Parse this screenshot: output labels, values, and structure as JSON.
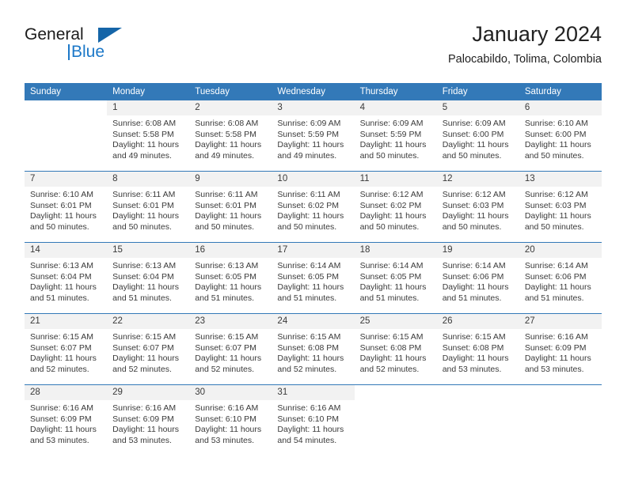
{
  "brand": {
    "word_one": "General",
    "word_two": "Blue",
    "triangle_icon": "triangle-icon",
    "accent_color": "#1c78c8",
    "dark_color": "#1b1b1b"
  },
  "header": {
    "title": "January 2024",
    "subtitle": "Palocabildo, Tolima, Colombia",
    "header_bg": "#3379b8",
    "daynum_bg": "#f2f2f2"
  },
  "weekdays": [
    "Sunday",
    "Monday",
    "Tuesday",
    "Wednesday",
    "Thursday",
    "Friday",
    "Saturday"
  ],
  "weeks": [
    [
      {
        "day": "",
        "sunrise": "",
        "sunset": "",
        "daylight_line1": "",
        "daylight_line2": ""
      },
      {
        "day": "1",
        "sunrise": "Sunrise: 6:08 AM",
        "sunset": "Sunset: 5:58 PM",
        "daylight_line1": "Daylight: 11 hours",
        "daylight_line2": "and 49 minutes."
      },
      {
        "day": "2",
        "sunrise": "Sunrise: 6:08 AM",
        "sunset": "Sunset: 5:58 PM",
        "daylight_line1": "Daylight: 11 hours",
        "daylight_line2": "and 49 minutes."
      },
      {
        "day": "3",
        "sunrise": "Sunrise: 6:09 AM",
        "sunset": "Sunset: 5:59 PM",
        "daylight_line1": "Daylight: 11 hours",
        "daylight_line2": "and 49 minutes."
      },
      {
        "day": "4",
        "sunrise": "Sunrise: 6:09 AM",
        "sunset": "Sunset: 5:59 PM",
        "daylight_line1": "Daylight: 11 hours",
        "daylight_line2": "and 50 minutes."
      },
      {
        "day": "5",
        "sunrise": "Sunrise: 6:09 AM",
        "sunset": "Sunset: 6:00 PM",
        "daylight_line1": "Daylight: 11 hours",
        "daylight_line2": "and 50 minutes."
      },
      {
        "day": "6",
        "sunrise": "Sunrise: 6:10 AM",
        "sunset": "Sunset: 6:00 PM",
        "daylight_line1": "Daylight: 11 hours",
        "daylight_line2": "and 50 minutes."
      }
    ],
    [
      {
        "day": "7",
        "sunrise": "Sunrise: 6:10 AM",
        "sunset": "Sunset: 6:01 PM",
        "daylight_line1": "Daylight: 11 hours",
        "daylight_line2": "and 50 minutes."
      },
      {
        "day": "8",
        "sunrise": "Sunrise: 6:11 AM",
        "sunset": "Sunset: 6:01 PM",
        "daylight_line1": "Daylight: 11 hours",
        "daylight_line2": "and 50 minutes."
      },
      {
        "day": "9",
        "sunrise": "Sunrise: 6:11 AM",
        "sunset": "Sunset: 6:01 PM",
        "daylight_line1": "Daylight: 11 hours",
        "daylight_line2": "and 50 minutes."
      },
      {
        "day": "10",
        "sunrise": "Sunrise: 6:11 AM",
        "sunset": "Sunset: 6:02 PM",
        "daylight_line1": "Daylight: 11 hours",
        "daylight_line2": "and 50 minutes."
      },
      {
        "day": "11",
        "sunrise": "Sunrise: 6:12 AM",
        "sunset": "Sunset: 6:02 PM",
        "daylight_line1": "Daylight: 11 hours",
        "daylight_line2": "and 50 minutes."
      },
      {
        "day": "12",
        "sunrise": "Sunrise: 6:12 AM",
        "sunset": "Sunset: 6:03 PM",
        "daylight_line1": "Daylight: 11 hours",
        "daylight_line2": "and 50 minutes."
      },
      {
        "day": "13",
        "sunrise": "Sunrise: 6:12 AM",
        "sunset": "Sunset: 6:03 PM",
        "daylight_line1": "Daylight: 11 hours",
        "daylight_line2": "and 50 minutes."
      }
    ],
    [
      {
        "day": "14",
        "sunrise": "Sunrise: 6:13 AM",
        "sunset": "Sunset: 6:04 PM",
        "daylight_line1": "Daylight: 11 hours",
        "daylight_line2": "and 51 minutes."
      },
      {
        "day": "15",
        "sunrise": "Sunrise: 6:13 AM",
        "sunset": "Sunset: 6:04 PM",
        "daylight_line1": "Daylight: 11 hours",
        "daylight_line2": "and 51 minutes."
      },
      {
        "day": "16",
        "sunrise": "Sunrise: 6:13 AM",
        "sunset": "Sunset: 6:05 PM",
        "daylight_line1": "Daylight: 11 hours",
        "daylight_line2": "and 51 minutes."
      },
      {
        "day": "17",
        "sunrise": "Sunrise: 6:14 AM",
        "sunset": "Sunset: 6:05 PM",
        "daylight_line1": "Daylight: 11 hours",
        "daylight_line2": "and 51 minutes."
      },
      {
        "day": "18",
        "sunrise": "Sunrise: 6:14 AM",
        "sunset": "Sunset: 6:05 PM",
        "daylight_line1": "Daylight: 11 hours",
        "daylight_line2": "and 51 minutes."
      },
      {
        "day": "19",
        "sunrise": "Sunrise: 6:14 AM",
        "sunset": "Sunset: 6:06 PM",
        "daylight_line1": "Daylight: 11 hours",
        "daylight_line2": "and 51 minutes."
      },
      {
        "day": "20",
        "sunrise": "Sunrise: 6:14 AM",
        "sunset": "Sunset: 6:06 PM",
        "daylight_line1": "Daylight: 11 hours",
        "daylight_line2": "and 51 minutes."
      }
    ],
    [
      {
        "day": "21",
        "sunrise": "Sunrise: 6:15 AM",
        "sunset": "Sunset: 6:07 PM",
        "daylight_line1": "Daylight: 11 hours",
        "daylight_line2": "and 52 minutes."
      },
      {
        "day": "22",
        "sunrise": "Sunrise: 6:15 AM",
        "sunset": "Sunset: 6:07 PM",
        "daylight_line1": "Daylight: 11 hours",
        "daylight_line2": "and 52 minutes."
      },
      {
        "day": "23",
        "sunrise": "Sunrise: 6:15 AM",
        "sunset": "Sunset: 6:07 PM",
        "daylight_line1": "Daylight: 11 hours",
        "daylight_line2": "and 52 minutes."
      },
      {
        "day": "24",
        "sunrise": "Sunrise: 6:15 AM",
        "sunset": "Sunset: 6:08 PM",
        "daylight_line1": "Daylight: 11 hours",
        "daylight_line2": "and 52 minutes."
      },
      {
        "day": "25",
        "sunrise": "Sunrise: 6:15 AM",
        "sunset": "Sunset: 6:08 PM",
        "daylight_line1": "Daylight: 11 hours",
        "daylight_line2": "and 52 minutes."
      },
      {
        "day": "26",
        "sunrise": "Sunrise: 6:15 AM",
        "sunset": "Sunset: 6:08 PM",
        "daylight_line1": "Daylight: 11 hours",
        "daylight_line2": "and 53 minutes."
      },
      {
        "day": "27",
        "sunrise": "Sunrise: 6:16 AM",
        "sunset": "Sunset: 6:09 PM",
        "daylight_line1": "Daylight: 11 hours",
        "daylight_line2": "and 53 minutes."
      }
    ],
    [
      {
        "day": "28",
        "sunrise": "Sunrise: 6:16 AM",
        "sunset": "Sunset: 6:09 PM",
        "daylight_line1": "Daylight: 11 hours",
        "daylight_line2": "and 53 minutes."
      },
      {
        "day": "29",
        "sunrise": "Sunrise: 6:16 AM",
        "sunset": "Sunset: 6:09 PM",
        "daylight_line1": "Daylight: 11 hours",
        "daylight_line2": "and 53 minutes."
      },
      {
        "day": "30",
        "sunrise": "Sunrise: 6:16 AM",
        "sunset": "Sunset: 6:10 PM",
        "daylight_line1": "Daylight: 11 hours",
        "daylight_line2": "and 53 minutes."
      },
      {
        "day": "31",
        "sunrise": "Sunrise: 6:16 AM",
        "sunset": "Sunset: 6:10 PM",
        "daylight_line1": "Daylight: 11 hours",
        "daylight_line2": "and 54 minutes."
      },
      {
        "day": "",
        "sunrise": "",
        "sunset": "",
        "daylight_line1": "",
        "daylight_line2": ""
      },
      {
        "day": "",
        "sunrise": "",
        "sunset": "",
        "daylight_line1": "",
        "daylight_line2": ""
      },
      {
        "day": "",
        "sunrise": "",
        "sunset": "",
        "daylight_line1": "",
        "daylight_line2": ""
      }
    ]
  ]
}
